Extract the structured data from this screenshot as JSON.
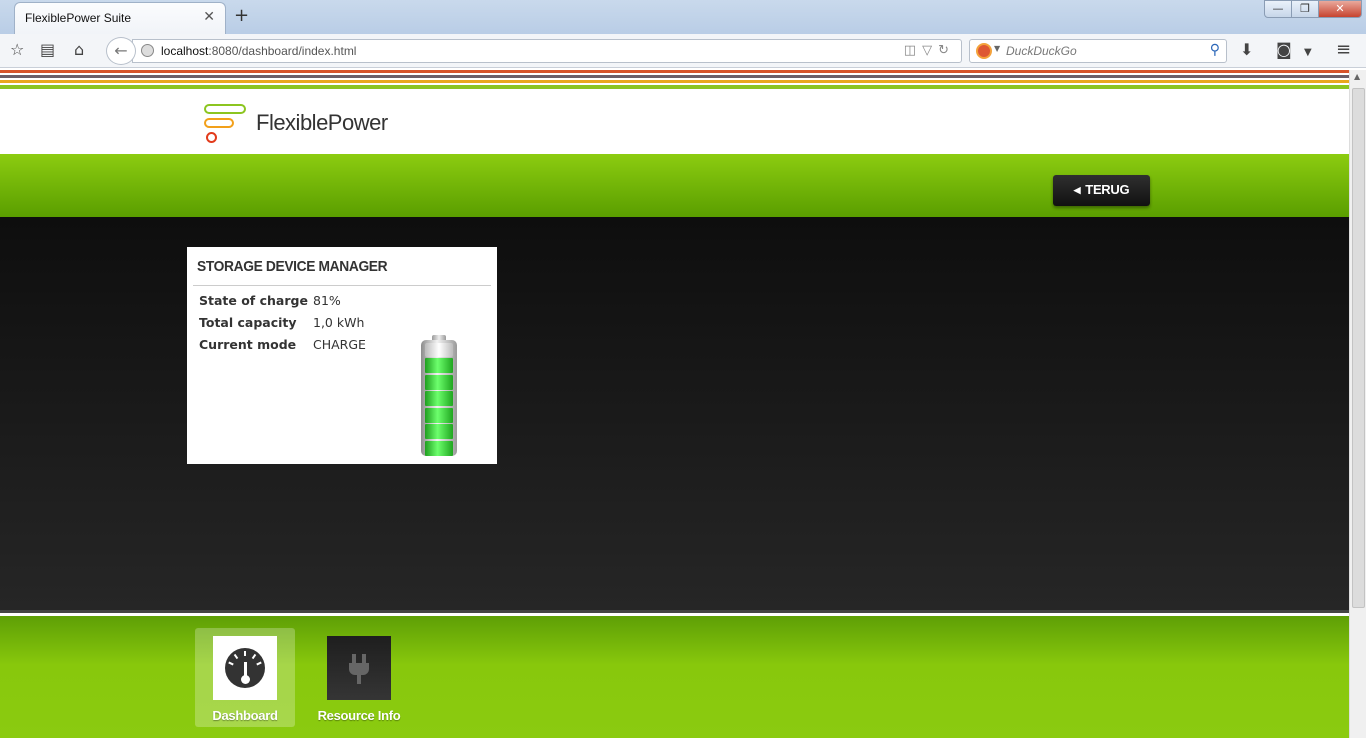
{
  "browser": {
    "tab_title": "FlexiblePower Suite",
    "tab_close": "✕",
    "new_tab": "+",
    "window_buttons": {
      "minimize": "—",
      "restore": "❐",
      "close": "✕"
    },
    "url_host": "localhost",
    "url_rest": ":8080/dashboard/index.html",
    "search_placeholder": "DuckDuckGo"
  },
  "colors": {
    "brand_green": "#8ccc10",
    "stripe_colors": [
      "#d6532a",
      "#6b5f6a",
      "#e9a81c",
      "#8cc520"
    ]
  },
  "header": {
    "logo_text": "FlexiblePower"
  },
  "toolbar": {
    "back_label": "TERUG"
  },
  "widget": {
    "title": "STORAGE DEVICE MANAGER",
    "rows": [
      {
        "label": "State of charge",
        "value": "81%"
      },
      {
        "label": "Total capacity",
        "value": "1,0 kWh"
      },
      {
        "label": "Current mode",
        "value": "CHARGE"
      }
    ],
    "battery_level": 0.81
  },
  "footer": {
    "items": [
      {
        "label": "Dashboard",
        "icon": "dashboard-gauge-icon",
        "active": true
      },
      {
        "label": "Resource Info",
        "icon": "plug-icon",
        "active": false
      }
    ]
  }
}
